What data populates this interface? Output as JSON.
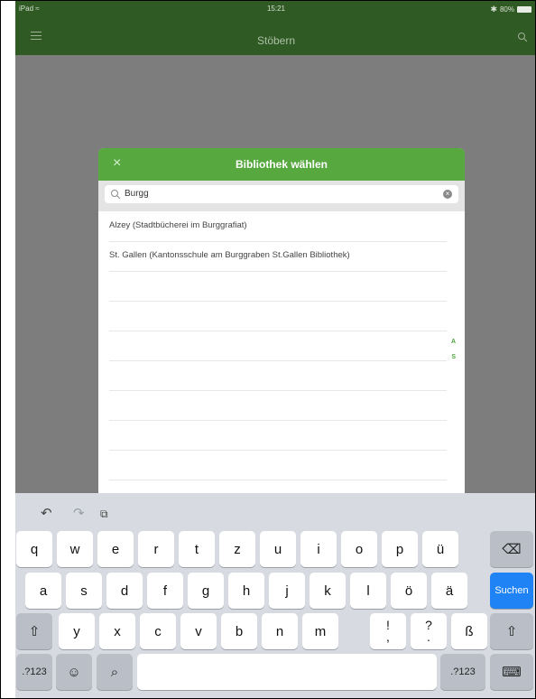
{
  "status_bar": {
    "device": "iPad",
    "time": "15:21",
    "battery": "80%"
  },
  "app": {
    "title": "Stöbern"
  },
  "modal": {
    "title": "Bibliothek wählen",
    "search": {
      "value": "Burgg"
    },
    "results": [
      "Alzey (Stadtbücherei im Burggrafiat)",
      "St. Gallen (Kantonsschule am Burggraben St.Gallen Bibliothek)"
    ],
    "index": [
      "A",
      "S"
    ]
  },
  "keyboard": {
    "row1": [
      "q",
      "w",
      "e",
      "r",
      "t",
      "z",
      "u",
      "i",
      "o",
      "p",
      "ü"
    ],
    "row2": [
      "a",
      "s",
      "d",
      "f",
      "g",
      "h",
      "j",
      "k",
      "l",
      "ö",
      "ä"
    ],
    "row3": [
      "y",
      "x",
      "c",
      "v",
      "b",
      "n",
      "m"
    ],
    "punct": [
      {
        "top": "!",
        "bottom": ","
      },
      {
        "top": "?",
        "bottom": "."
      }
    ],
    "sharp_s": "ß",
    "return_label": "Suchen",
    "numbers_label": ".?123"
  }
}
